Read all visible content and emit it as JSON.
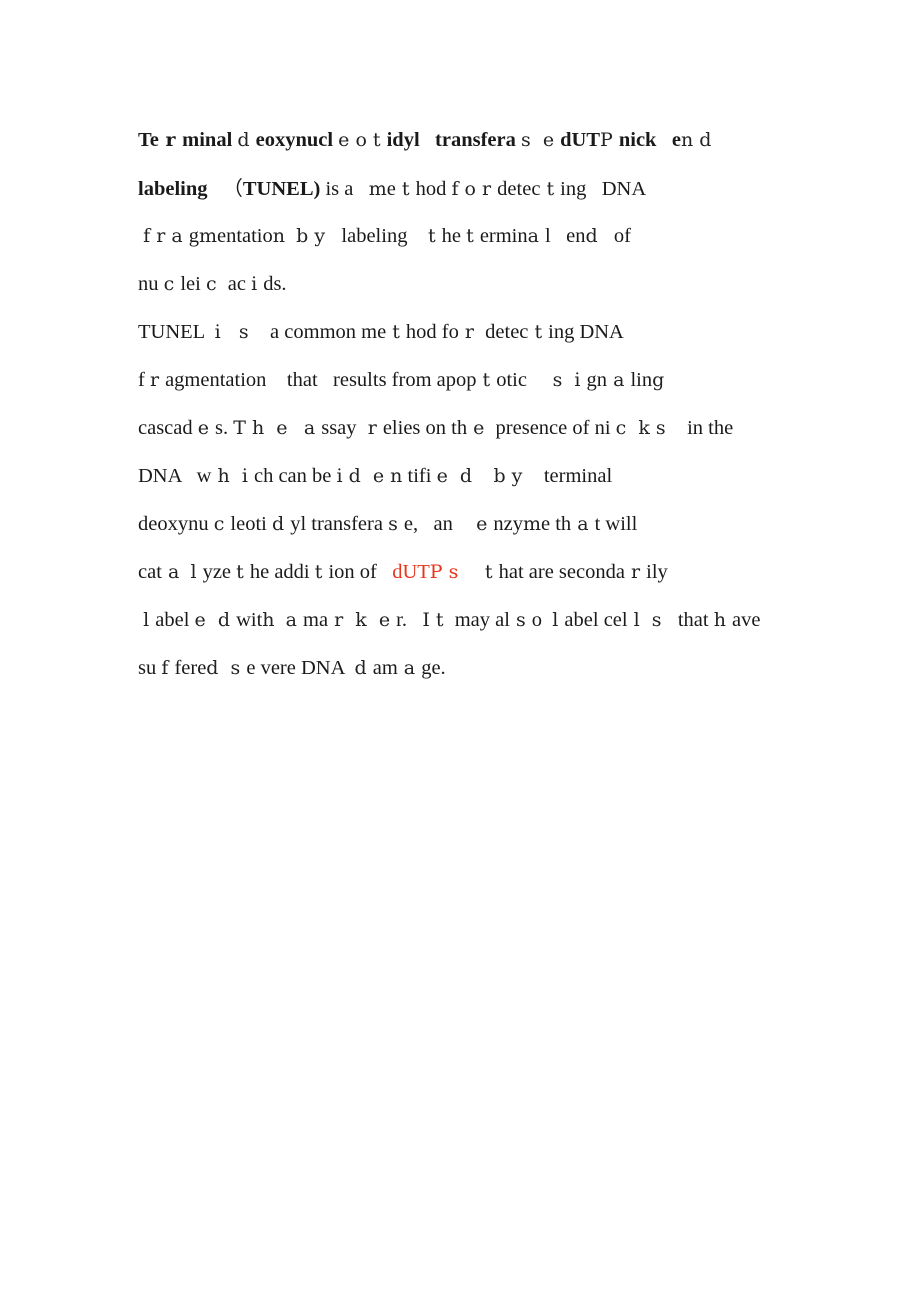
{
  "document": {
    "page_background": "#ffffff",
    "text_color": "#1a1a1a",
    "accent_color": "#e8361a",
    "full_text": "Terminal deoxynucleotidyl transferase dUTP nick end labeling （TUNEL) is a method for detecting DNA fragmentation by labeling the terminal end of nucleic acids. TUNEL is a common method for detecting DNA fragmentation that results from apoptotic signaling cascades. The assay relies on the presence of nicks in the DNA which can be identified by terminal deoxynucleotidyl transferase, an enzyme that will catalyze the addition of dUTPs that are secondarily labeled with a marker. It may also label cells that have suffered severe DNA damage.",
    "lines": [
      {
        "id": "line-1",
        "runs": [
          {
            "text": "Te",
            "style": "bold"
          },
          {
            "text": " r ",
            "style": "bold-alt"
          },
          {
            "text": "minal ",
            "style": "bold"
          },
          {
            "text": "d ",
            "style": "alt"
          },
          {
            "text": "eoxynucl ",
            "style": "bold"
          },
          {
            "text": "e o t ",
            "style": "alt"
          },
          {
            "text": "idyl",
            "style": "bold"
          },
          {
            "text": "   ",
            "style": "bold"
          },
          {
            "text": "transfera ",
            "style": "bold"
          },
          {
            "text": "s  e ",
            "style": "alt"
          },
          {
            "text": "dUT",
            "style": "bold"
          },
          {
            "text": "P ",
            "style": "alt"
          },
          {
            "text": "nick",
            "style": "bold"
          },
          {
            "text": "   ",
            "style": "bold"
          },
          {
            "text": "e",
            "style": "bold"
          },
          {
            "text": "n d",
            "style": "alt"
          }
        ]
      },
      {
        "id": "line-2",
        "runs": [
          {
            "text": "labeling",
            "style": "bold"
          },
          {
            "text": "   ",
            "style": "bold"
          },
          {
            "text": "（",
            "style": "fullwidth-paren"
          },
          {
            "text": "TUNEL",
            "style": "bold"
          },
          {
            "text": ")",
            "style": "bold"
          },
          {
            "text": " is a   ",
            "style": "regular"
          },
          {
            "text": "m",
            "style": "alt"
          },
          {
            "text": "e",
            "style": "regular"
          },
          {
            "text": " t ",
            "style": "alt"
          },
          {
            "text": "hod ",
            "style": "regular"
          },
          {
            "text": "f o r ",
            "style": "alt"
          },
          {
            "text": "detec",
            "style": "regular"
          },
          {
            "text": " t ",
            "style": "alt"
          },
          {
            "text": "ing   DNA",
            "style": "regular"
          }
        ]
      },
      {
        "id": "line-3",
        "runs": [
          {
            "text": " ",
            "style": "regular"
          },
          {
            "text": "f r a ",
            "style": "alt"
          },
          {
            "text": "g",
            "style": "regular"
          },
          {
            "text": "m",
            "style": "alt"
          },
          {
            "text": "entatio",
            "style": "regular"
          },
          {
            "text": "n ",
            "style": "alt"
          },
          {
            "text": " ",
            "style": "regular"
          },
          {
            "text": "b y ",
            "style": "alt"
          },
          {
            "text": "  labeling    ",
            "style": "regular"
          },
          {
            "text": "t ",
            "style": "alt"
          },
          {
            "text": "he ",
            "style": "regular"
          },
          {
            "text": "t ",
            "style": "alt"
          },
          {
            "text": "ermin",
            "style": "regular"
          },
          {
            "text": "a ",
            "style": "alt"
          },
          {
            "text": "l",
            "style": "regular"
          },
          {
            "text": "   en",
            "style": "regular"
          },
          {
            "text": "d ",
            "style": "alt"
          },
          {
            "text": "  of",
            "style": "regular"
          }
        ]
      },
      {
        "id": "line-4",
        "runs": [
          {
            "text": "nu ",
            "style": "regular"
          },
          {
            "text": "c ",
            "style": "alt"
          },
          {
            "text": "lei ",
            "style": "regular"
          },
          {
            "text": "c ",
            "style": "alt"
          },
          {
            "text": " ac ",
            "style": "regular"
          },
          {
            "text": "i ",
            "style": "alt"
          },
          {
            "text": "ds.",
            "style": "regular"
          }
        ]
      },
      {
        "id": "line-5",
        "runs": [
          {
            "text": "TUNEL  ",
            "style": "regular"
          },
          {
            "text": "i   s ",
            "style": "alt"
          },
          {
            "text": "   a common me",
            "style": "regular"
          },
          {
            "text": " t ",
            "style": "alt"
          },
          {
            "text": "hod fo",
            "style": "regular"
          },
          {
            "text": " r ",
            "style": "alt"
          },
          {
            "text": " detec",
            "style": "regular"
          },
          {
            "text": " t ",
            "style": "alt"
          },
          {
            "text": "ing DNA",
            "style": "regular"
          }
        ]
      },
      {
        "id": "line-6",
        "runs": [
          {
            "text": "f ",
            "style": "regular"
          },
          {
            "text": "r ",
            "style": "alt"
          },
          {
            "text": "agmentation    that   results from apop",
            "style": "regular"
          },
          {
            "text": " t ",
            "style": "alt"
          },
          {
            "text": "otic",
            "style": "regular"
          },
          {
            "text": "     ",
            "style": "regular"
          },
          {
            "text": "s  i ",
            "style": "alt"
          },
          {
            "text": "gn",
            "style": "regular"
          },
          {
            "text": " a ",
            "style": "alt"
          },
          {
            "text": "lin",
            "style": "regular"
          },
          {
            "text": "g",
            "style": "alt"
          }
        ]
      },
      {
        "id": "line-7",
        "runs": [
          {
            "text": "cascad ",
            "style": "regular"
          },
          {
            "text": "e ",
            "style": "alt"
          },
          {
            "text": "s. ",
            "style": "regular"
          },
          {
            "text": "T h  e ",
            "style": "alt"
          },
          {
            "text": "  ",
            "style": "regular"
          },
          {
            "text": "a ",
            "style": "alt"
          },
          {
            "text": "ssay ",
            "style": "regular"
          },
          {
            "text": " r ",
            "style": "alt"
          },
          {
            "text": "elies on th",
            "style": "regular"
          },
          {
            "text": " e ",
            "style": "alt"
          },
          {
            "text": " presence of ni ",
            "style": "regular"
          },
          {
            "text": "c  k s ",
            "style": "alt"
          },
          {
            "text": "   in the",
            "style": "regular"
          }
        ]
      },
      {
        "id": "line-8",
        "runs": [
          {
            "text": "DNA   ",
            "style": "regular"
          },
          {
            "text": "w",
            "style": "regular"
          },
          {
            "text": " h  i ",
            "style": "alt"
          },
          {
            "text": "ch can be ",
            "style": "regular"
          },
          {
            "text": "i d  e ",
            "style": "alt"
          },
          {
            "text": "n",
            "style": "alt"
          },
          {
            "text": " tifi ",
            "style": "regular"
          },
          {
            "text": "e  d ",
            "style": "alt"
          },
          {
            "text": "   ",
            "style": "regular"
          },
          {
            "text": "b y ",
            "style": "alt"
          },
          {
            "text": "   terminal",
            "style": "regular"
          }
        ]
      },
      {
        "id": "line-9",
        "runs": [
          {
            "text": "deoxynu ",
            "style": "regular"
          },
          {
            "text": "c ",
            "style": "alt"
          },
          {
            "text": "leoti ",
            "style": "regular"
          },
          {
            "text": "d ",
            "style": "alt"
          },
          {
            "text": "yl transfera ",
            "style": "regular"
          },
          {
            "text": "s ",
            "style": "alt"
          },
          {
            "text": "e,   an ",
            "style": "regular"
          },
          {
            "text": "   e ",
            "style": "alt"
          },
          {
            "text": "nzy",
            "style": "regular"
          },
          {
            "text": "m",
            "style": "alt"
          },
          {
            "text": "e th",
            "style": "regular"
          },
          {
            "text": " a ",
            "style": "alt"
          },
          {
            "text": "t will",
            "style": "regular"
          }
        ]
      },
      {
        "id": "line-10",
        "runs": [
          {
            "text": "cat",
            "style": "regular"
          },
          {
            "text": " a ",
            "style": "alt"
          },
          {
            "text": " ",
            "style": "regular"
          },
          {
            "text": "l ",
            "style": "alt"
          },
          {
            "text": "yze ",
            "style": "regular"
          },
          {
            "text": "t ",
            "style": "alt"
          },
          {
            "text": "he addi ",
            "style": "regular"
          },
          {
            "text": "t ",
            "style": "alt"
          },
          {
            "text": "ion of  ",
            "style": "regular"
          },
          {
            "text": " dUT",
            "style": "red"
          },
          {
            "text": "P ",
            "style": "red-alt"
          },
          {
            "text": "s ",
            "style": "red-alt"
          },
          {
            "text": "    ",
            "style": "regular"
          },
          {
            "text": "t ",
            "style": "alt"
          },
          {
            "text": "hat are seconda",
            "style": "regular"
          },
          {
            "text": " r ",
            "style": "alt"
          },
          {
            "text": "ily",
            "style": "regular"
          }
        ]
      },
      {
        "id": "line-11",
        "runs": [
          {
            "text": " ",
            "style": "regular"
          },
          {
            "text": "l ",
            "style": "alt"
          },
          {
            "text": "abel ",
            "style": "regular"
          },
          {
            "text": "e  d ",
            "style": "alt"
          },
          {
            "text": "wit",
            "style": "regular"
          },
          {
            "text": "h ",
            "style": "alt"
          },
          {
            "text": " ",
            "style": "regular"
          },
          {
            "text": "a ",
            "style": "alt"
          },
          {
            "text": "ma",
            "style": "regular"
          },
          {
            "text": " r  k  e ",
            "style": "alt"
          },
          {
            "text": "r.   ",
            "style": "regular"
          },
          {
            "text": "I t ",
            "style": "alt"
          },
          {
            "text": " may al",
            "style": "regular"
          },
          {
            "text": " s ",
            "style": "alt"
          },
          {
            "text": "o  ",
            "style": "regular"
          },
          {
            "text": "l ",
            "style": "alt"
          },
          {
            "text": "abel cel",
            "style": "regular"
          },
          {
            "text": " l  s ",
            "style": "alt"
          },
          {
            "text": "  that ",
            "style": "regular"
          },
          {
            "text": "h ",
            "style": "alt"
          },
          {
            "text": "ave",
            "style": "regular"
          }
        ]
      },
      {
        "id": "line-12",
        "runs": [
          {
            "text": "su ",
            "style": "regular"
          },
          {
            "text": "f ",
            "style": "alt"
          },
          {
            "text": "fere",
            "style": "regular"
          },
          {
            "text": "d  s ",
            "style": "alt"
          },
          {
            "text": "e ",
            "style": "regular"
          },
          {
            "text": "vere DNA  ",
            "style": "regular"
          },
          {
            "text": "d ",
            "style": "alt"
          },
          {
            "text": "am",
            "style": "regular"
          },
          {
            "text": " a ",
            "style": "alt"
          },
          {
            "text": "ge.",
            "style": "regular"
          }
        ]
      }
    ]
  }
}
